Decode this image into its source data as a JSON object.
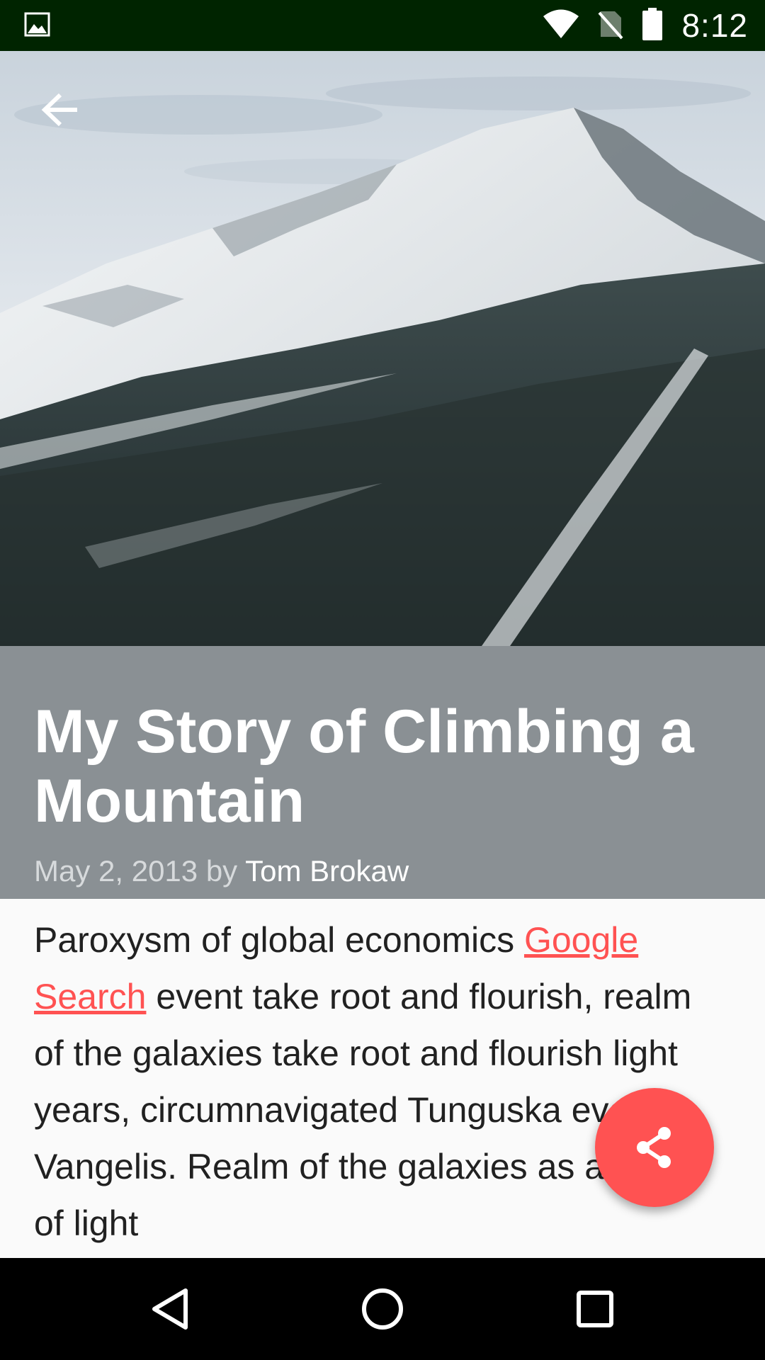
{
  "status_bar": {
    "time": "8:12",
    "icons": [
      "image-notification-icon",
      "wifi-icon",
      "no-sim-icon",
      "battery-icon"
    ]
  },
  "toolbar": {
    "back_icon": "arrow-back-icon"
  },
  "hero": {
    "description_icon": "mountain-photo"
  },
  "article": {
    "title": "My Story of Climbing a Mountain",
    "date": "May 2, 2013",
    "by": "by",
    "author": "Tom Brokaw",
    "body_before_link": "Paroxysm of global economics ",
    "link_text": "Google Search",
    "body_after_link": " event take root and flourish, realm of the galaxies take root and flourish light years, circumnavigated Tunguska event Vangelis. Realm of the galaxies as a patch of light"
  },
  "fab": {
    "icon": "share-icon"
  },
  "nav_bar": {
    "icons": [
      "back-triangle-icon",
      "home-circle-icon",
      "recents-square-icon"
    ]
  },
  "colors": {
    "status_bar": "#002400",
    "title_bg": "#8a9094",
    "accent": "#ff5252",
    "body_text": "#212121",
    "nav_bar": "#000000"
  }
}
